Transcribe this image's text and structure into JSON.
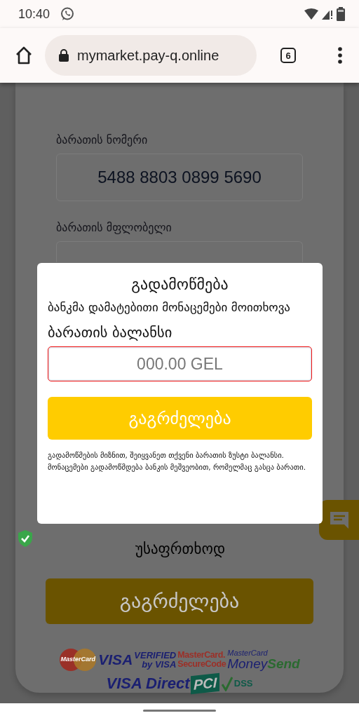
{
  "status_bar": {
    "time": "10:40"
  },
  "browser": {
    "url": "mymarket.pay-q.online",
    "tab_count": "6"
  },
  "form": {
    "fields": [
      {
        "label": "ბარათის ნომერი",
        "value": "5488 8803 0899 5690"
      },
      {
        "label": "ბარათის მფლობელი"
      }
    ],
    "secure_label": "უსაფრთხოდ",
    "submit": "გაგრძელება",
    "logos": [
      {
        "kind": "mc",
        "text": "MasterCard"
      },
      {
        "kind": "visa",
        "text": "VISA"
      },
      {
        "kind": "verified",
        "lines": [
          "VERIFIED",
          "by VISA"
        ]
      },
      {
        "kind": "securecode",
        "lines": [
          "MasterCard.",
          "SecureCode"
        ]
      },
      {
        "kind": "moneysend",
        "lines": [
          "MasterCard",
          "Money",
          "Send"
        ]
      },
      {
        "kind": "visadirect",
        "text": "VISA Direct"
      },
      {
        "kind": "pci",
        "lines": [
          "PCI",
          "DSS"
        ]
      }
    ]
  },
  "dialog": {
    "title": "გადამოწმება",
    "message": "ბანკმა დამატებითი მონაცემები მოითხოვა",
    "field_label": "ბარათის ბალანსი",
    "placeholder": "000.00 GEL",
    "invalid": true,
    "button": "გაგრძელება",
    "note": "გადამოწმების მიზნით, შეიყვანეთ თქვენი ბარათის ზუსტი ბალანსი. მონაცემები გადამოწმდება ბანკის მეშვეობით, რომელმაც გასცა ბარათი."
  }
}
